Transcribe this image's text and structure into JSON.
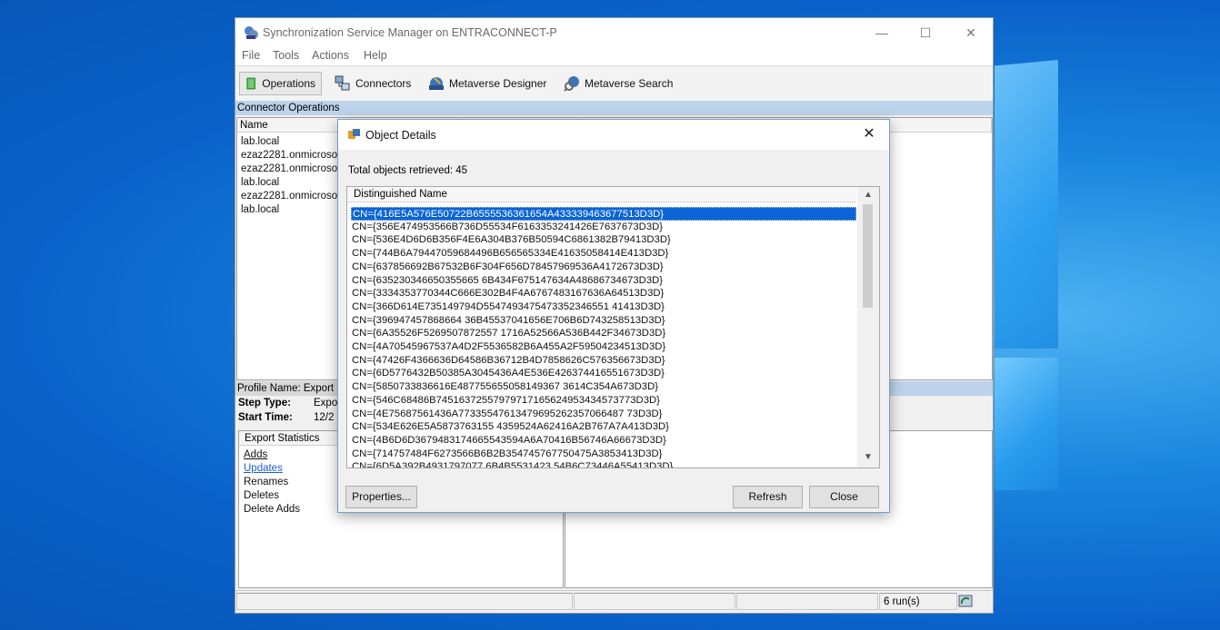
{
  "window": {
    "title": "Synchronization Service Manager on ENTRACONNECT-P",
    "controls": {
      "minimize": "—",
      "maximize": "☐",
      "close": "✕"
    }
  },
  "menu": [
    "File",
    "Tools",
    "Actions",
    "Help"
  ],
  "toolbar": [
    {
      "label": "Operations",
      "icon": "operations-icon"
    },
    {
      "label": "Connectors",
      "icon": "connectors-icon"
    },
    {
      "label": "Metaverse Designer",
      "icon": "metaverse-designer-icon"
    },
    {
      "label": "Metaverse Search",
      "icon": "metaverse-search-icon"
    }
  ],
  "connector_operations": {
    "header": "Connector Operations",
    "column_name": "Name",
    "rows": [
      "lab.local",
      "ezaz2281.onmicrosoft",
      "ezaz2281.onmicrosoft",
      "lab.local",
      "ezaz2281.onmicrosoft",
      "lab.local"
    ]
  },
  "profile": {
    "header": "Profile Name: Export  U",
    "step_type_label": "Step Type:",
    "step_type_value": "Expor",
    "start_time_label": "Start Time:",
    "start_time_value": "12/2"
  },
  "export_statistics": {
    "header": "Export Statistics",
    "items": [
      "Adds",
      "Updates",
      "Renames",
      "Deletes",
      "Delete Adds"
    ]
  },
  "statusbar": {
    "runs": "6 run(s)"
  },
  "dialog": {
    "title": "Object Details",
    "total": "Total objects retrieved: 45",
    "column": "Distinguished Name",
    "rows": [
      "CN={416E5A576E50722B6555536361654A433339463677513D3D}",
      "CN={356E474953566B736D55534F6163353241426E7637673D3D}",
      "CN={536E4D6D6B356F4E6A304B376B50594C6861382B79413D3D}",
      "CN={744B6A79447059684496B656565334E41635058414E413D3D}",
      "CN={637856692B67532B6F304F656D78457969536A4172673D3D}",
      "CN={635230346650355665 6B434F675147634A48686734673D3D}",
      "CN={3334353770344C666E302B4F4A6767483167636A64513D3D}",
      "CN={366D614E735149794D5547493475473352346551 41413D3D}",
      "CN={396947457868664 36B45537041656E706B6D743258513D3D}",
      "CN={6A35526F5269507872557 1716A52566A536B442F34673D3D}",
      "CN={4A70545967537A4D2F5536582B6A455A2F59504234513D3D}",
      "CN={47426F4366636D64586B36712B4D7858626C576356673D3D}",
      "CN={6D5776432B50385A3045436A4E536E426374416551673D3D}",
      "CN={5850733836616E487755655058149367 3614C354A673D3D}",
      "CN={546C68486B74516372557979717165624953434573773D3D}",
      "CN={4E75687561436A77335547613479695262357066487 73D3D}",
      "CN={534E626E5A5873763155 4359524A62416A2B767A7A413D3D}",
      "CN={4B6D6D3679483174665543594A6A70416B56746A66673D3D}",
      "CN={714757484F6273566B6B2B354745767750475A3853413D3D}",
      "CN={6D5A392B4931797077 6B4B5531423 54B6C73446A55413D3D}"
    ],
    "buttons": {
      "properties": "Properties...",
      "refresh": "Refresh",
      "close": "Close"
    },
    "close_glyph": "✕"
  }
}
